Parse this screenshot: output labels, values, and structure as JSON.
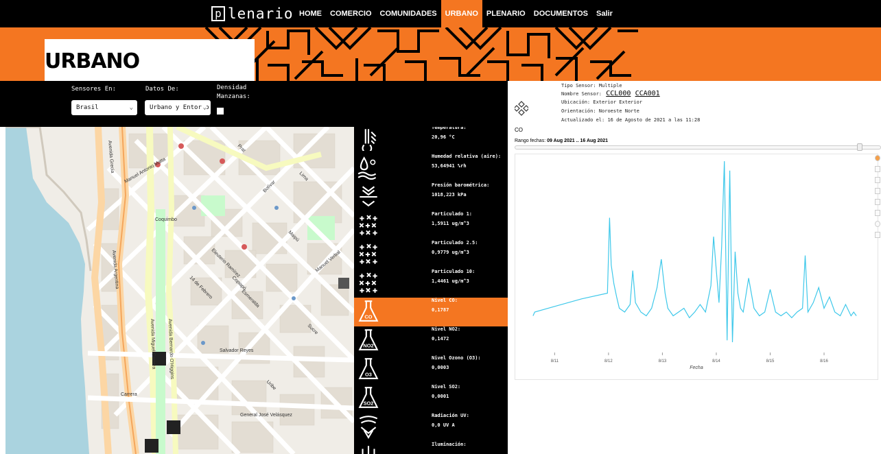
{
  "nav": {
    "logo_text": "lenario",
    "logo_glyph": "p",
    "items": [
      {
        "label": "HOME",
        "active": false
      },
      {
        "label": "COMERCIO",
        "active": false
      },
      {
        "label": "COMUNIDADES",
        "active": false
      },
      {
        "label": "URBANO",
        "active": true
      },
      {
        "label": "PLENARIO",
        "active": false
      },
      {
        "label": "DOCUMENTOS",
        "active": false
      },
      {
        "label": "Salir",
        "active": false
      }
    ],
    "accent_color": "#f47621"
  },
  "hero": {
    "title": "URBANO"
  },
  "filters": {
    "sensores_label": "Sensores En:",
    "sensores_value": "Brasil",
    "datos_label": "Datos De:",
    "datos_value": "Urbano y Entorno",
    "densidad_label_1": "Densidad",
    "densidad_label_2": "Manzanas:",
    "densidad_checked": false
  },
  "map": {
    "streets": [
      "Avenida Grecia",
      "Manuel Antonio Matta",
      "Coquimbo",
      "Avenida Argentina",
      "Avenida Miguel Carrera",
      "Avenida Bernardo O'Higgins",
      "Salvador Reyes",
      "Carrera",
      "General José Velásquez",
      "14 de Febrero",
      "Eleuterio Ramírez",
      "Maipú",
      "Copiapó",
      "Esmeralda",
      "Manuel Verbal",
      "Uribe",
      "Sucre",
      "Prat",
      "Lima",
      "Bolívar"
    ]
  },
  "sensors": [
    {
      "name": "Temperatura:",
      "value": "20,96 °C",
      "icon": "thermometer-icon",
      "active": false
    },
    {
      "name": "Humedad relativa (aire):",
      "value": "53,64941 %rh",
      "icon": "humidity-icon",
      "active": false
    },
    {
      "name": "Presión barométrica:",
      "value": "1018,223 kPa",
      "icon": "pressure-icon",
      "active": false
    },
    {
      "name": "Particulado 1:",
      "value": "1,5911 ug/m^3",
      "icon": "particles-icon",
      "active": false
    },
    {
      "name": "Particulado 2.5:",
      "value": "0,9779 ug/m^3",
      "icon": "particles-icon",
      "active": false
    },
    {
      "name": "Particulado 10:",
      "value": "1,4461 ug/m^3",
      "icon": "particles-icon",
      "active": false
    },
    {
      "name": "Nivel CO:",
      "value": "0,1787",
      "icon": "flask-co-icon",
      "active": true
    },
    {
      "name": "Nivel NO2:",
      "value": "0,1472",
      "icon": "flask-no2-icon",
      "active": false
    },
    {
      "name": "Nivel Ozono (O3):",
      "value": "0,0003",
      "icon": "flask-o3-icon",
      "active": false
    },
    {
      "name": "Nivel SO2:",
      "value": "0,0001",
      "icon": "flask-so2-icon",
      "active": false
    },
    {
      "name": "Radiación UV:",
      "value": "0,0 UV A",
      "icon": "uv-icon",
      "active": false
    },
    {
      "name": "Iluminación:",
      "value": "",
      "icon": "light-icon",
      "active": false
    }
  ],
  "info": {
    "tipo_label": "Tipo Sensor:",
    "tipo_value": "Multiple",
    "nombre_label": "Nombre Sensor:",
    "nombre_links": [
      "CCL000",
      "CCA001"
    ],
    "ubicacion_label": "Ubicación:",
    "ubicacion_value": "Exterior Exterior",
    "orientacion_label": "Orientación:",
    "orientacion_value": "Noroeste Norte",
    "actualizado_label": "Actualizado el:",
    "actualizado_value": "16 de Agosto de 2021 a las 11:28",
    "gas": "CO",
    "range_label": "Rango fechas:",
    "range_value": "09 Aug 2021 .. 16 Aug 2021"
  },
  "chart_data": {
    "type": "line",
    "title": "",
    "xlabel": "Fecha",
    "ylabel": "",
    "x_ticks": [
      "8/11",
      "8/12",
      "8/13",
      "8/14",
      "8/15",
      "8/16"
    ],
    "line_color": "#3ec8ea",
    "series": [
      {
        "x": [
          10.6,
          10.63,
          11.0,
          11.5,
          11.98,
          12.02,
          12.05,
          12.1,
          12.15,
          12.2,
          12.3,
          12.4,
          12.45,
          12.5,
          12.6,
          12.7,
          12.8,
          12.9,
          12.98,
          13.05,
          13.1,
          13.2,
          13.3,
          13.4,
          13.5,
          13.6,
          13.7,
          13.8,
          13.9,
          13.95,
          14.0,
          14.05,
          14.1,
          14.15,
          14.2,
          14.25,
          14.3,
          14.35,
          14.4,
          14.45,
          14.5,
          14.6,
          14.7,
          14.8,
          14.9,
          15.0,
          15.1,
          15.2,
          15.3,
          15.4,
          15.5,
          15.6,
          15.65,
          15.7,
          15.8,
          15.9,
          16.0,
          16.1,
          16.2,
          16.3,
          16.4,
          16.5,
          16.55,
          16.6
        ],
        "y": [
          0.18,
          0.2,
          0.23,
          0.27,
          0.3,
          0.7,
          0.45,
          0.35,
          0.28,
          0.22,
          0.2,
          0.24,
          0.42,
          0.25,
          0.2,
          0.18,
          0.22,
          0.33,
          0.48,
          0.3,
          0.22,
          0.18,
          0.2,
          0.22,
          0.17,
          0.2,
          0.24,
          0.2,
          0.34,
          0.6,
          0.42,
          0.25,
          0.55,
          1.0,
          0.05,
          0.95,
          0.04,
          0.52,
          0.3,
          0.22,
          0.2,
          0.38,
          0.22,
          0.18,
          0.2,
          0.32,
          0.2,
          0.18,
          0.2,
          0.17,
          0.2,
          0.22,
          0.5,
          0.2,
          0.25,
          0.33,
          0.22,
          0.28,
          0.2,
          0.18,
          0.24,
          0.18,
          0.2,
          0.18
        ]
      }
    ]
  }
}
